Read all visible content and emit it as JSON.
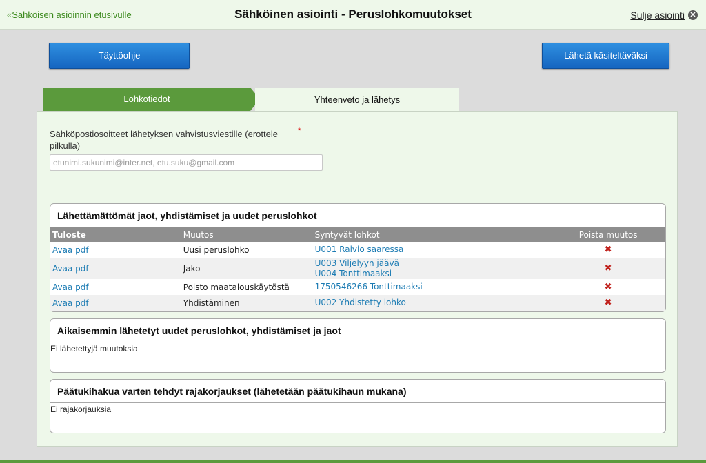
{
  "header": {
    "back_link": "«Sähköisen asioinnin etusivulle",
    "title": "Sähköinen asiointi  -  Peruslohkomuutokset",
    "close_label": "Sulje asiointi"
  },
  "buttons": {
    "help": "Täyttöohje",
    "send": "Lähetä käsiteltäväksi"
  },
  "tabs": [
    {
      "label": "Lohkotiedot"
    },
    {
      "label": "Yhteenveto ja lähetys"
    }
  ],
  "email": {
    "label": "Sähköpostiosoitteet lähetyksen vahvistusviestille (erottele pilkulla)",
    "required_mark": "*",
    "placeholder": "etunimi.sukunimi@inter.net, etu.suku@gmail.com"
  },
  "unsent": {
    "title": "Lähettämättömät jaot, yhdistämiset ja uudet peruslohkot",
    "columns": [
      "Tuloste",
      "Muutos",
      "Syntyvät lohkot",
      "Poista muutos"
    ],
    "rows": [
      {
        "print": "Avaa pdf",
        "change": "Uusi peruslohko",
        "blocks": [
          "U001 Raivio saaressa"
        ]
      },
      {
        "print": "Avaa pdf",
        "change": "Jako",
        "blocks": [
          "U003 Viljelyyn jäävä",
          "U004 Tonttimaaksi"
        ]
      },
      {
        "print": "Avaa pdf",
        "change": "Poisto maatalouskäytöstä",
        "blocks": [
          "1750546266 Tonttimaaksi"
        ]
      },
      {
        "print": "Avaa pdf",
        "change": "Yhdistäminen",
        "blocks": [
          "U002 Yhdistetty lohko"
        ]
      }
    ],
    "delete_glyph": "✖"
  },
  "sent": {
    "title": "Aikaisemmin lähetetyt uudet peruslohkot, yhdistämiset ja jaot",
    "empty": "Ei lähetettyjä muutoksia"
  },
  "corrections": {
    "title": "Päätukihakua varten tehdyt rajakorjaukset (lähetetään päätukihaun mukana)",
    "empty": "Ei rajakorjauksia"
  },
  "colors": {
    "green": "#5b9a3c",
    "light_green_bg": "#eef8ea",
    "button_blue": "#1565c0",
    "link_blue": "#1b7bb3",
    "delete_red": "#c0201b"
  },
  "icons": {
    "close": "close-circle-icon",
    "delete": "delete-x-icon"
  }
}
